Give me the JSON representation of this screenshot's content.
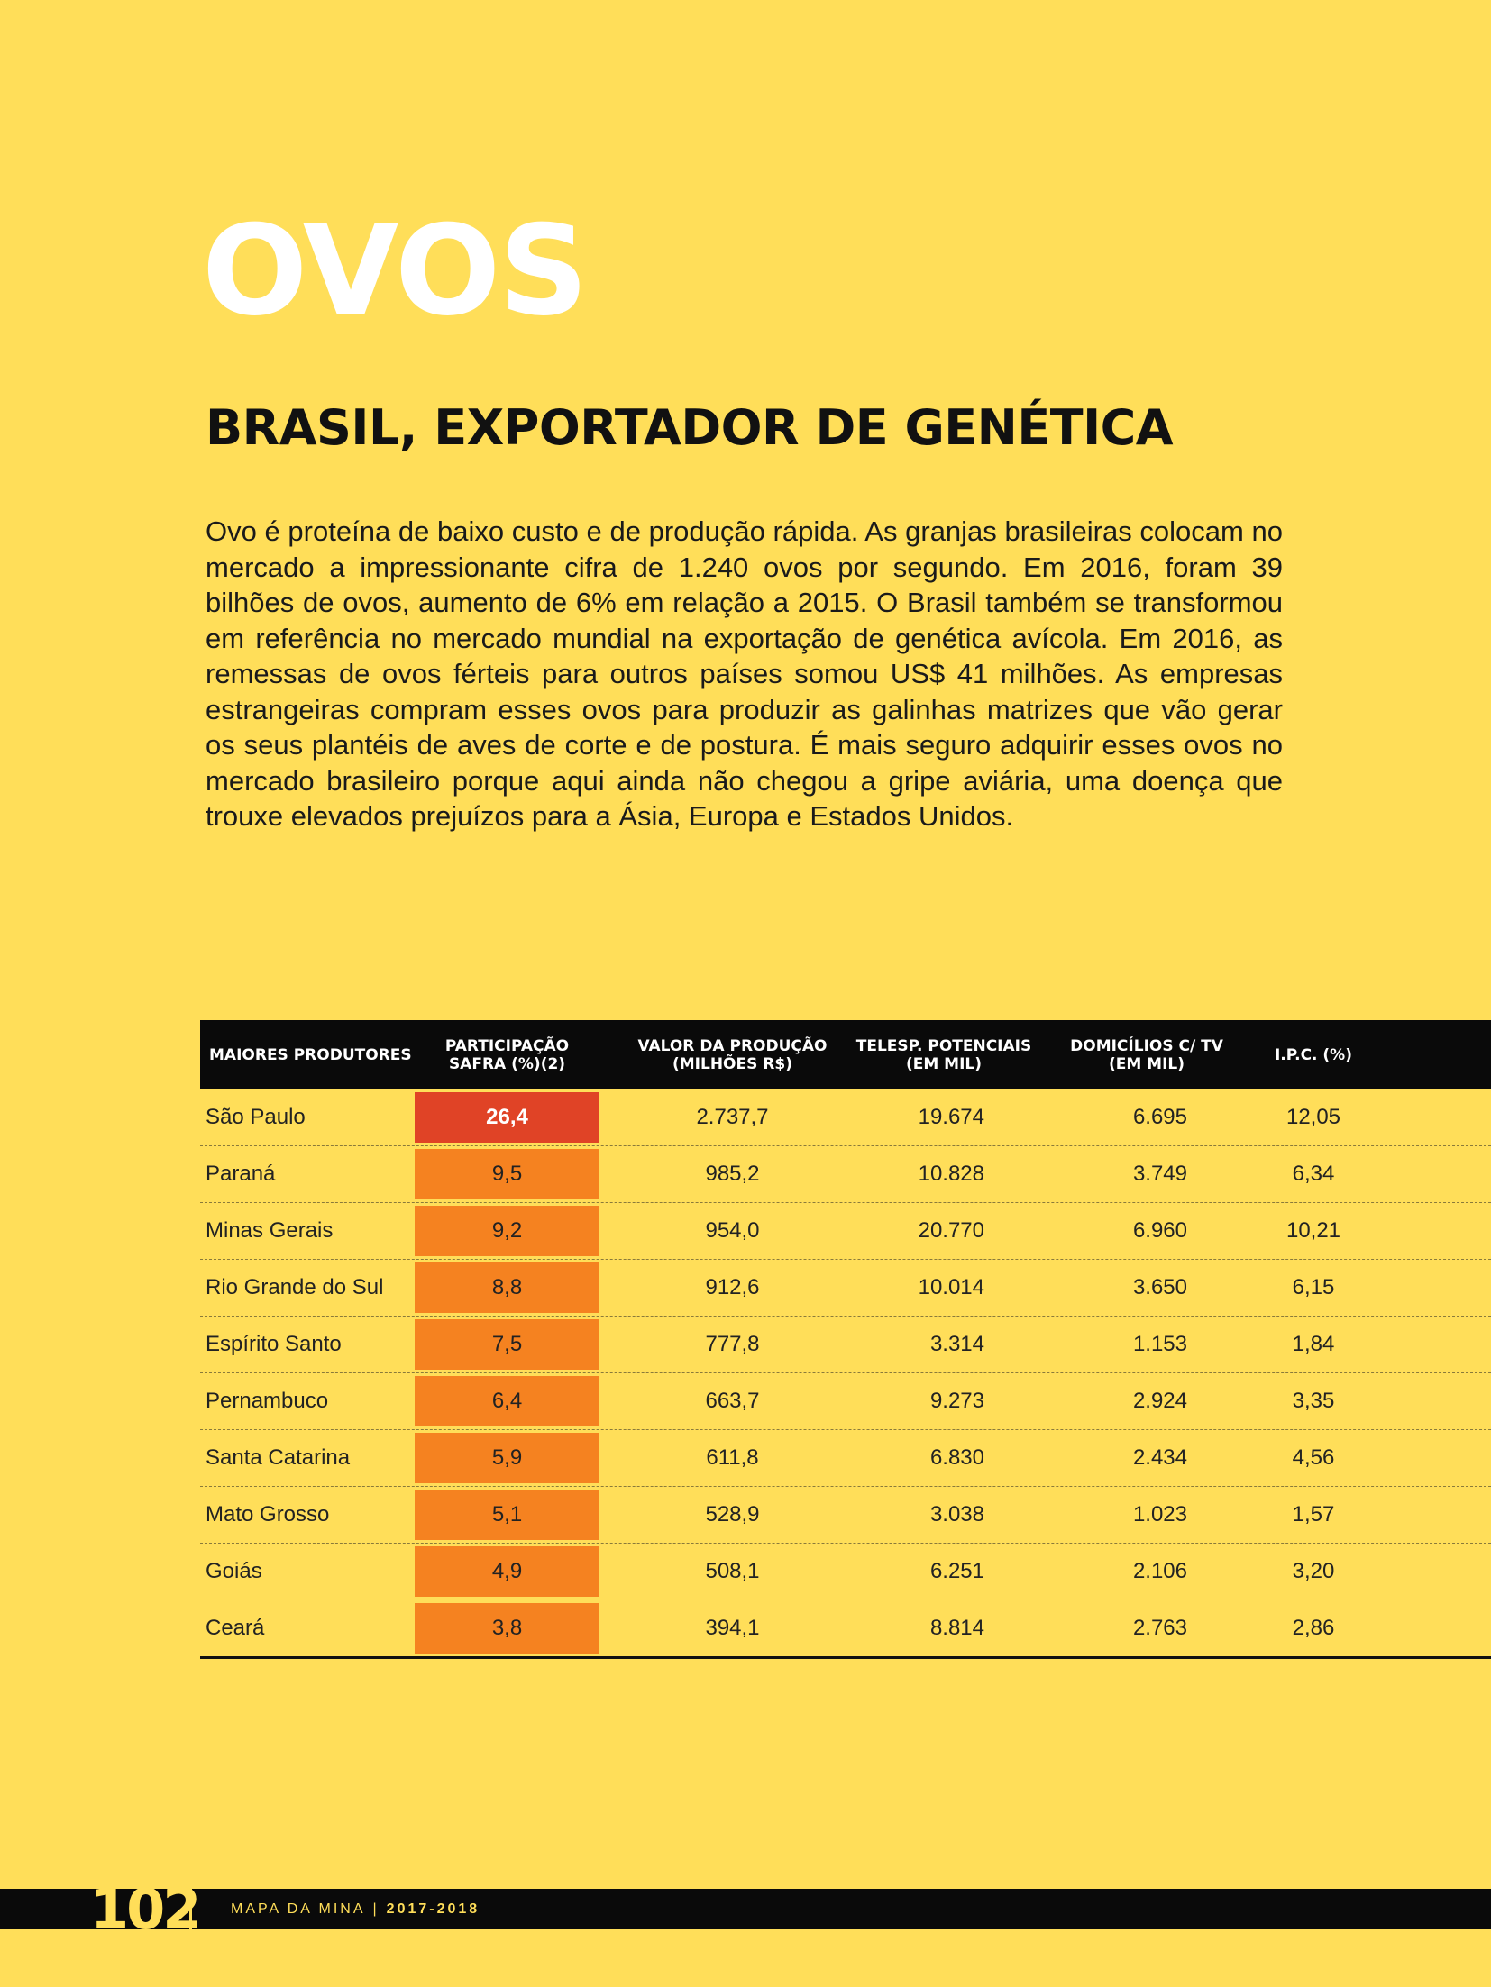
{
  "header": {
    "title": "OVOS",
    "subtitle": "BRASIL, EXPORTADOR DE GENÉTICA"
  },
  "article": {
    "body": "Ovo é proteína de baixo custo e de produção rápida. As granjas brasileiras colocam no mercado a impressionante cifra de 1.240 ovos por segundo. Em 2016, foram 39 bilhões de ovos, aumento de 6% em relação a 2015. O Brasil também se transformou em referência no mercado mundial na exportação de genética avícola. Em 2016, as remessas de ovos férteis para outros países somou US$ 41 milhões. As empresas estrangeiras compram esses ovos para produzir as galinhas matrizes que vão gerar os seus plantéis de aves de corte e de postura. É mais seguro adquirir esses ovos no mercado brasileiro porque aqui ainda não chegou a gripe aviária, uma doença que trouxe elevados prejuízos para a Ásia, Europa e Estados Unidos."
  },
  "table": {
    "headers": [
      "MAIORES PRODUTORES",
      "PARTICIPAÇÃO\nSAFRA (%)(2)",
      "VALOR DA PRODUÇÃO\n(MILHÕES R$)",
      "TELESP. POTENCIAIS\n(EM MIL)",
      "DOMICÍLIOS C/ TV\n(EM MIL)",
      "I.P.C. (%)"
    ],
    "rows": [
      [
        "São Paulo",
        "26,4",
        "2.737,7",
        "19.674",
        "6.695",
        "12,05"
      ],
      [
        "Paraná",
        "9,5",
        "985,2",
        "10.828",
        "3.749",
        "6,34"
      ],
      [
        "Minas Gerais",
        "9,2",
        "954,0",
        "20.770",
        "6.960",
        "10,21"
      ],
      [
        "Rio Grande do Sul",
        "8,8",
        "912,6",
        "10.014",
        "3.650",
        "6,15"
      ],
      [
        "Espírito Santo",
        "7,5",
        "777,8",
        "3.314",
        "1.153",
        "1,84"
      ],
      [
        "Pernambuco",
        "6,4",
        "663,7",
        "9.273",
        "2.924",
        "3,35"
      ],
      [
        "Santa Catarina",
        "5,9",
        "611,8",
        "6.830",
        "2.434",
        "4,56"
      ],
      [
        "Mato Grosso",
        "5,1",
        "528,9",
        "3.038",
        "1.023",
        "1,57"
      ],
      [
        "Goiás",
        "4,9",
        "508,1",
        "6.251",
        "2.106",
        "3,20"
      ],
      [
        "Ceará",
        "3,8",
        "394,1",
        "8.814",
        "2.763",
        "2,86"
      ]
    ]
  },
  "footer": {
    "page_number": "102",
    "publication": "MAPA DA MINA",
    "separator": "|",
    "year": "2017-2018"
  },
  "colors": {
    "background": "#FFDE59",
    "highlight_top": "#E04326",
    "highlight": "#F58220",
    "header_bg": "#0a0a0a"
  }
}
